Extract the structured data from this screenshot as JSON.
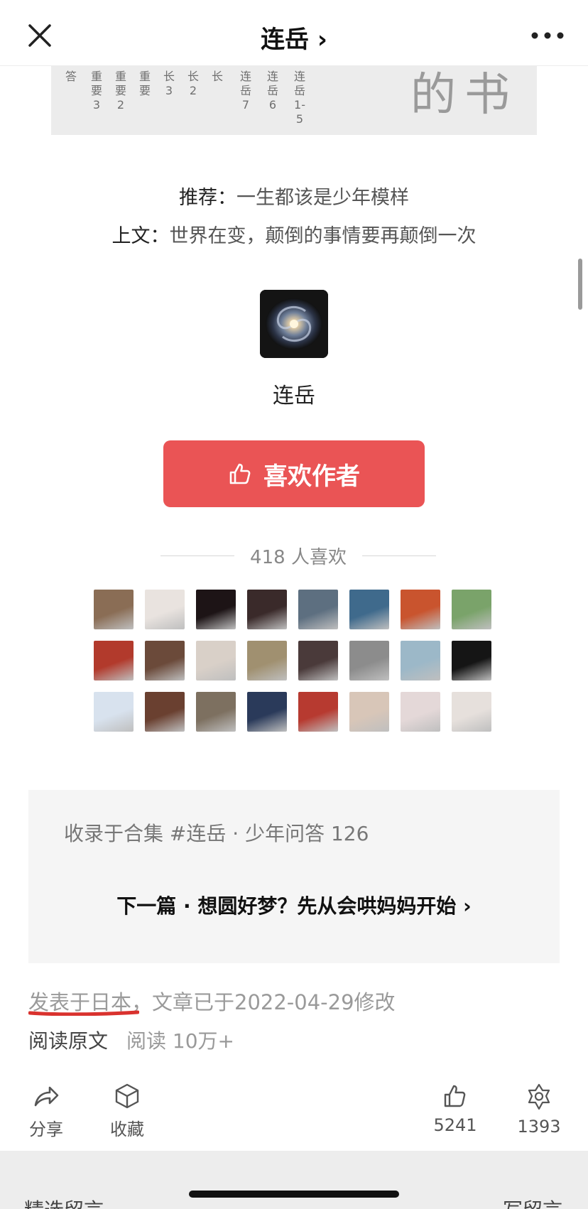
{
  "nav": {
    "title": "连岳 ›",
    "close_icon": "close-icon",
    "more_icon": "more-dots-icon"
  },
  "banner": {
    "columns": [
      "答",
      "重要3",
      "重要2",
      "重要",
      "长3",
      "长2",
      "长",
      "连岳7",
      "连岳6",
      "连岳1-5"
    ],
    "big_text": "的书"
  },
  "recommend": {
    "label": "推荐：",
    "title": "一生都该是少年模样"
  },
  "previous": {
    "label": "上文：",
    "title": "世界在变，颠倒的事情要再颠倒一次"
  },
  "author": {
    "name": "连岳",
    "avatar": "galaxy-avatar"
  },
  "like_button": {
    "label": "喜欢作者",
    "icon": "thumbs-up-icon"
  },
  "likes_count_text": "418 人喜欢",
  "liker_avatar_colors": [
    "#8a6d55",
    "#e9e3df",
    "#1d1416",
    "#3a2a2a",
    "#5d6f80",
    "#3f6a8c",
    "#c9542e",
    "#7aa36a",
    "#b23a2c",
    "#6b4a3a",
    "#d9d0c8",
    "#a09070",
    "#4a3a3a",
    "#8c8c8c",
    "#9cb8c8",
    "#151515",
    "#d8e2ee",
    "#6a4030",
    "#7d7060",
    "#2a3a5a",
    "#b73a30",
    "#d8c6b8",
    "#e4d8d8",
    "#e6e0dc"
  ],
  "collection": {
    "tag_text": "收录于合集 #连岳 · 少年问答 126",
    "next_text": "下一篇 · 想圆好梦？先从会哄妈妈开始 ›"
  },
  "meta": {
    "published": "发表于日本，文章已于2022-04-29修改",
    "underline_color": "#d9322e"
  },
  "read": {
    "original_label": "阅读原文",
    "reads": "阅读 10万+"
  },
  "actions": {
    "share": {
      "label": "分享",
      "icon": "share-icon"
    },
    "favorite": {
      "label": "收藏",
      "icon": "cube-icon"
    },
    "like": {
      "label": "5241",
      "icon": "thumbs-up-icon"
    },
    "wow": {
      "label": "1393",
      "icon": "star-flower-icon"
    }
  },
  "comments": {
    "left_label": "精选留言",
    "right_label": "写留言"
  }
}
